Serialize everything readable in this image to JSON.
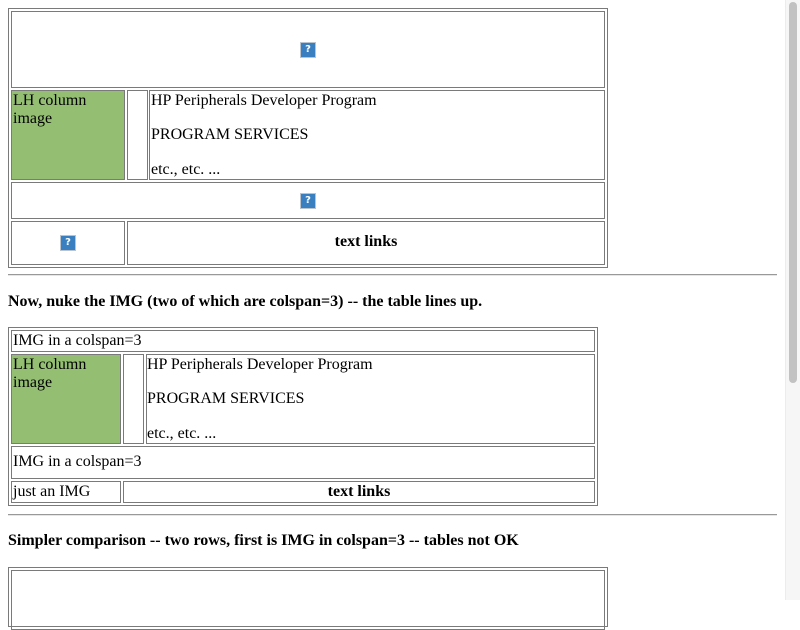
{
  "table1": {
    "lh_image_text": "LH column image",
    "program_title": "HP Peripherals Developer Program",
    "program_services": "PROGRAM SERVICES",
    "etc": "etc., etc. ...",
    "text_links": "text links",
    "broken_image_glyph": "?"
  },
  "heading2": "Now, nuke the IMG (two of which are colspan=3) -- the table lines up.",
  "table2": {
    "img_colspan_1": "IMG in a colspan=3",
    "lh_image_text": "LH column image",
    "program_title": "HP Peripherals Developer Program",
    "program_services": "PROGRAM SERVICES",
    "etc": "etc., etc. ...",
    "img_colspan_2": "IMG in a colspan=3",
    "just_an_img": "just an IMG",
    "text_links": "text links"
  },
  "heading3": "Simpler comparison -- two rows, first is IMG in colspan=3 -- tables not OK",
  "colors": {
    "green_cell": "#94bf73",
    "border": "#7a7a7a",
    "broken_image_blue": "#3a80c1"
  }
}
